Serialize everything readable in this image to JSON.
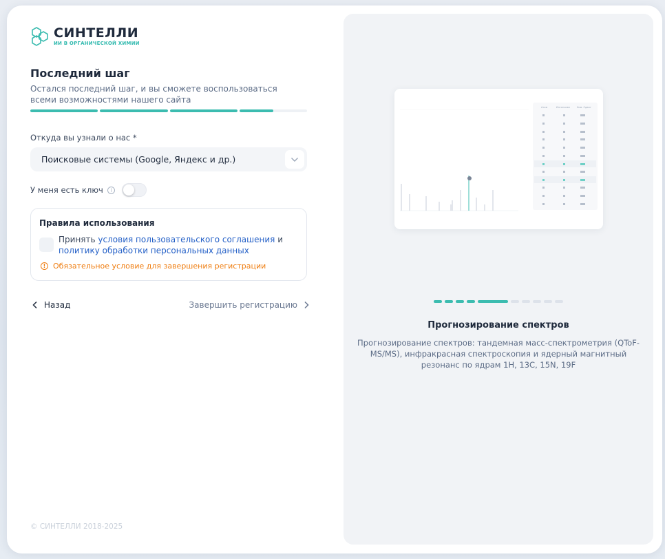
{
  "brand": {
    "name": "СИНТЕЛЛИ",
    "tagline": "ИИ В ОРГАНИЧЕСКОЙ ХИМИИ",
    "accent": "#3cbcb0"
  },
  "step": {
    "title": "Последний шаг",
    "description": "Остался последний шаг, и вы сможете воспользоваться всеми возможностями нашего сайта",
    "progress": [
      1,
      1,
      1,
      0.5
    ]
  },
  "source_field": {
    "label": "Откуда вы узнали о нас *",
    "value": "Поисковые системы (Google, Яндекс и др.)"
  },
  "key_toggle": {
    "label": "У меня есть ключ",
    "checked": false
  },
  "rules": {
    "title": "Правила использования",
    "accept_prefix": "Принять",
    "link_agreement": "условия пользовательского соглашения",
    "accept_and": "и",
    "link_privacy": "политику обработки персональных данных",
    "warning": "Обязательное условие для завершения регистрации",
    "checked": false
  },
  "nav": {
    "back": "Назад",
    "finish": "Завершить регистрацию"
  },
  "footer": {
    "copyright": "© СИНТЕЛЛИ 2018-2025"
  },
  "carousel": {
    "active_index": 5,
    "count": 10,
    "title": "Прогнозирование спектров",
    "description": "Прогнозирование спектров: тандемная масс-спектрометрия (QToF-MS/MS), инфракрасная спектроскопия и ядерный магнитный резонанс по ядрам 1H, 13C, 15N, 19F"
  }
}
